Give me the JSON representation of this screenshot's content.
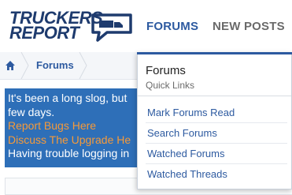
{
  "logo": {
    "line1": "TRUCKERS",
    "line2": "REPORT"
  },
  "nav": {
    "forums": "FORUMS",
    "new_posts": "NEW POSTS"
  },
  "breadcrumb": {
    "home_icon": "home-icon",
    "current": "Forums"
  },
  "notice": {
    "line1": "It's been a long slog, but",
    "line2": "few days.",
    "link1": "Report Bugs Here",
    "link2": "Discuss The Upgrade He",
    "line5": "Having trouble logging in"
  },
  "dropdown": {
    "title": "Forums",
    "subtitle": "Quick Links",
    "items": [
      "Mark Forums Read",
      "Search Forums",
      "Watched Forums",
      "Watched Threads"
    ]
  },
  "colors": {
    "brand": "#1e3b6e",
    "link": "#2d5aa0",
    "notice_bg": "#2e6fb8",
    "notice_link": "#f59a3a"
  }
}
